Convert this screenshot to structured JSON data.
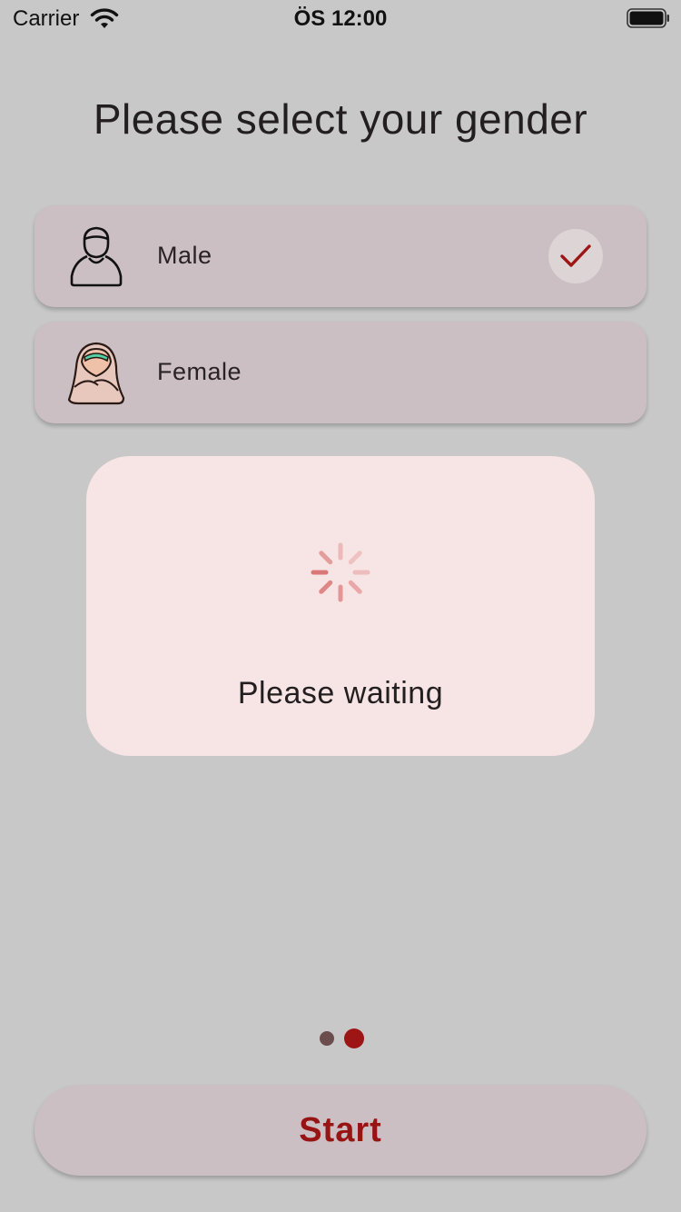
{
  "status_bar": {
    "carrier": "Carrier",
    "time": "ÖS 12:00",
    "icons": [
      "wifi-icon",
      "battery-icon"
    ]
  },
  "title": "Please select your gender",
  "options": [
    {
      "label": "Male",
      "icon": "male-person-icon",
      "selected": true
    },
    {
      "label": "Female",
      "icon": "female-hijab-person-icon",
      "selected": false
    }
  ],
  "loading": {
    "text": "Please waiting",
    "icon": "spinner-icon"
  },
  "pagination": {
    "total": 2,
    "current": 2
  },
  "start_button": {
    "label": "Start"
  },
  "colors": {
    "background": "#c8c8c8",
    "card": "#cbbfc3",
    "accent": "#9e1515",
    "dialog": "#f7e4e4"
  }
}
